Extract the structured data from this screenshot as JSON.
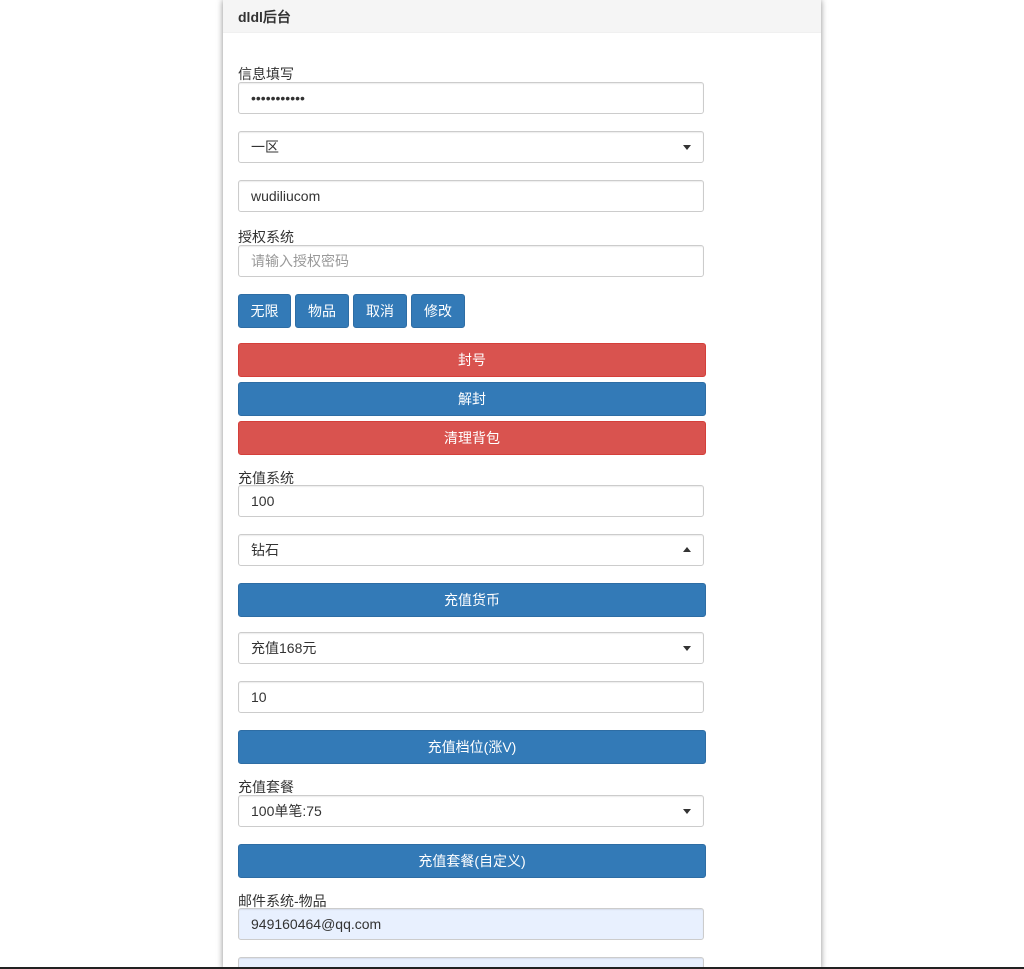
{
  "header": {
    "title": "dldl后台"
  },
  "info_section": {
    "label": "信息填写",
    "password_value": "•••••••••••",
    "server_select": "一区",
    "username_value": "wudiliucom"
  },
  "auth_section": {
    "label": "授权系统",
    "password_placeholder": "请输入授权密码",
    "buttons": [
      "无限",
      "物品",
      "取消",
      "修改"
    ],
    "ban_button": "封号",
    "unban_button": "解封",
    "clear_bag_button": "清理背包"
  },
  "recharge_section": {
    "label": "充值系统",
    "amount_value": "100",
    "currency_select": "钻石",
    "recharge_currency_button": "充值货币",
    "tier_select": "充值168元",
    "tier_count_value": "10",
    "recharge_tier_button": "充值档位(涨V)"
  },
  "package_section": {
    "label": "充值套餐",
    "package_select": "100单笔:75",
    "recharge_package_button": "充值套餐(自定义)"
  },
  "mail_section": {
    "label": "邮件系统-物品",
    "email_value": "949160464@qq.com"
  },
  "colors": {
    "primary": "#337ab7",
    "danger": "#d9534f",
    "autofill": "#e8f0fe"
  }
}
